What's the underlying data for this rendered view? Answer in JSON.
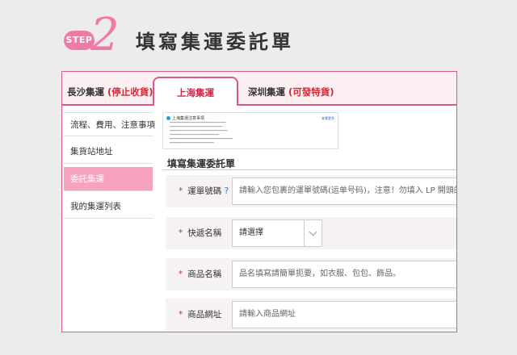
{
  "header": {
    "step_badge": "STEP",
    "step_number": "2",
    "title": "填寫集運委託單"
  },
  "tabs": [
    {
      "label": "長沙集運",
      "note": "(停止收貨)"
    },
    {
      "label": "上海集運",
      "note": ""
    },
    {
      "label": "深圳集運",
      "note": "(可發特貨)"
    }
  ],
  "sidebar": {
    "items": [
      {
        "label": "流程、費用、注意事項"
      },
      {
        "label": "集貨站地址"
      },
      {
        "label": "委託集運"
      },
      {
        "label": "我的集運列表"
      }
    ]
  },
  "notice": {
    "title": "上海集運注意事項",
    "link": "查看更多"
  },
  "form": {
    "title": "填寫集運委託單",
    "tracking": {
      "label": "運單號碼",
      "help": "?",
      "placeholder": "請輸入您包裹的運單號碼(运单号码)，注意！勿填入 LP 開頭的物流"
    },
    "courier": {
      "label": "快遞名稱",
      "selected": "請選擇"
    },
    "product_name": {
      "label": "商品名稱",
      "placeholder": "品名填寫請簡單扼要，如衣服、包包、飾品。"
    },
    "product_url": {
      "label": "商品網址",
      "placeholder": "請輸入商品網址"
    },
    "required_mark": "*"
  }
}
